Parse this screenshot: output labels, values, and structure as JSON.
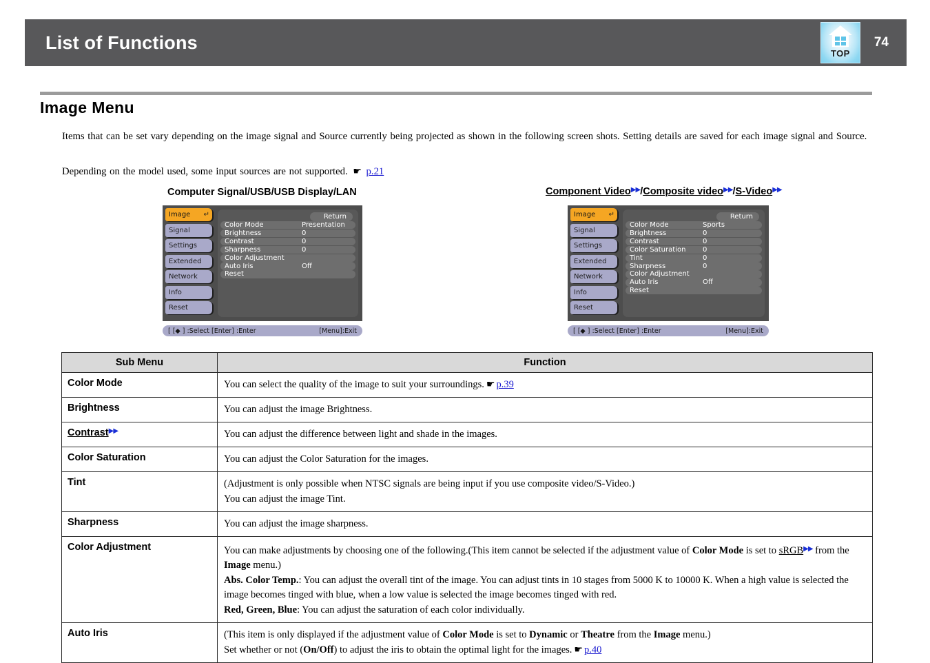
{
  "header": {
    "title": "List of Functions",
    "page_number": "74",
    "top_icon_label": "TOP",
    "bar_color": "#58585a"
  },
  "section": {
    "title": "Image Menu",
    "paragraph1": "Items that can be set vary depending on the image signal and Source currently being projected as shown in the following screen shots. Setting details are saved for each image signal and Source.",
    "paragraph2_text": "Depending on the model used, some input sources are not supported.",
    "paragraph2_link": "p.21",
    "link_icon": "☛",
    "glossary_icon": "▶▶",
    "link_color": "#1a1ad0",
    "glossary_color": "#1a2fd6"
  },
  "osd_left": {
    "caption": "Computer Signal/USB/USB Display/LAN",
    "tabs": [
      {
        "label": "Image",
        "active": true,
        "enter_icon": "↵"
      },
      {
        "label": "Signal",
        "active": false
      },
      {
        "label": "Settings",
        "active": false
      },
      {
        "label": "Extended",
        "active": false
      },
      {
        "label": "Network",
        "active": false
      },
      {
        "label": "Info",
        "active": false
      },
      {
        "label": "Reset",
        "active": false
      }
    ],
    "return_label": "Return",
    "rows": [
      {
        "name": "Color Mode",
        "value": "Presentation"
      },
      {
        "name": "Brightness",
        "value": "0"
      },
      {
        "name": "Contrast",
        "value": "0"
      },
      {
        "name": "Sharpness",
        "value": "0"
      },
      {
        "name": "Color Adjustment",
        "value": ""
      },
      {
        "name": "Auto Iris",
        "value": "Off"
      },
      {
        "name": "Reset",
        "value": ""
      }
    ],
    "status_left": "[ [◆ ] :Select  [Enter] :Enter",
    "status_right": "[Menu]:Exit",
    "accent_color": "#f5a623",
    "tab_color": "#a9a9c9",
    "panel_color": "#585858"
  },
  "osd_right": {
    "caption_parts": [
      {
        "text": "Component Video",
        "underline": true
      },
      {
        "text": "gloss",
        "underline": false
      },
      {
        "text": "/",
        "underline": false
      },
      {
        "text": "Composite video",
        "underline": true
      },
      {
        "text": "gloss",
        "underline": false
      },
      {
        "text": "/",
        "underline": false
      },
      {
        "text": "S-Video",
        "underline": true
      },
      {
        "text": "gloss",
        "underline": false
      }
    ],
    "caption_plain": "Component Video/Composite video/S-Video",
    "tabs": [
      {
        "label": "Image",
        "active": true,
        "enter_icon": "↵"
      },
      {
        "label": "Signal",
        "active": false
      },
      {
        "label": "Settings",
        "active": false
      },
      {
        "label": "Extended",
        "active": false
      },
      {
        "label": "Network",
        "active": false
      },
      {
        "label": "Info",
        "active": false
      },
      {
        "label": "Reset",
        "active": false
      }
    ],
    "return_label": "Return",
    "rows": [
      {
        "name": "Color Mode",
        "value": "Sports"
      },
      {
        "name": "Brightness",
        "value": "0"
      },
      {
        "name": "Contrast",
        "value": "0"
      },
      {
        "name": "Color Saturation",
        "value": "0"
      },
      {
        "name": "Tint",
        "value": "0"
      },
      {
        "name": "Sharpness",
        "value": "0"
      },
      {
        "name": "Color Adjustment",
        "value": ""
      },
      {
        "name": "Auto Iris",
        "value": "Off"
      },
      {
        "name": "Reset",
        "value": ""
      }
    ],
    "status_left": "[ [◆ ] :Select  [Enter] :Enter",
    "status_right": "[Menu]:Exit"
  },
  "table": {
    "headers": {
      "sub_menu": "Sub Menu",
      "function": "Function"
    },
    "rows": {
      "color_mode": {
        "name": "Color Mode",
        "text": "You can select the quality of the image to suit your surroundings.",
        "link": "p.39"
      },
      "brightness": {
        "name": "Brightness",
        "text": "You can adjust the image Brightness."
      },
      "contrast": {
        "name": "Contrast",
        "text": "You can adjust the difference between light and shade in the images."
      },
      "color_saturation": {
        "name": "Color Saturation",
        "text": "You can adjust the Color Saturation for the images."
      },
      "tint": {
        "name": "Tint",
        "line1": "(Adjustment is only possible when NTSC signals are being input if you use composite video/S-Video.)",
        "line2": "You can adjust the image Tint."
      },
      "sharpness": {
        "name": "Sharpness",
        "text": "You can adjust the image sharpness."
      },
      "color_adjustment": {
        "name": "Color Adjustment",
        "p1_a": "You can make adjustments by choosing one of the following.(This item cannot be selected if the adjustment value of ",
        "p1_bold1": "Color Mode",
        "p1_b": " is set to ",
        "p1_srgb": "sRGB",
        "p1_c": " from the ",
        "p1_bold2": "Image",
        "p1_d": " menu.)",
        "p2_bold": "Abs. Color Temp.",
        "p2_text": ": You can adjust the overall tint of the image. You can adjust tints in 10 stages from 5000 K to 10000 K. When a high value is selected the image becomes tinged with blue, when a low value is selected the image becomes tinged with red.",
        "p3_bold": "Red, Green, Blue",
        "p3_text": ": You can adjust the saturation of each color individually."
      },
      "auto_iris": {
        "name": "Auto Iris",
        "p1_a": "(This item is only displayed if the adjustment value of ",
        "p1_bold1": "Color Mode",
        "p1_b": " is set to ",
        "p1_bold2": "Dynamic",
        "p1_c": " or ",
        "p1_bold3": "Theatre",
        "p1_d": " from the ",
        "p1_bold4": "Image",
        "p1_e": " menu.)",
        "p2_a": "Set whether or not (",
        "p2_bold": "On/Off",
        "p2_b": ") to adjust the iris to obtain the optimal light for the images.",
        "p2_link": "p.40"
      }
    }
  }
}
